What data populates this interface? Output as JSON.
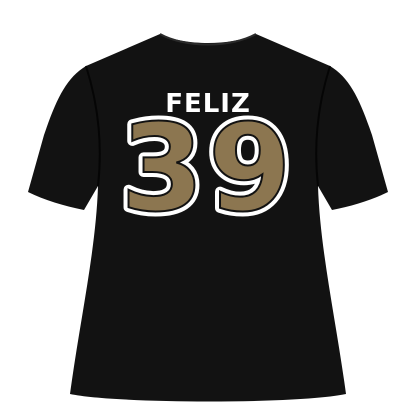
{
  "product": {
    "player_name": "FELIZ",
    "player_number": "39"
  },
  "colors": {
    "background": "#ffffff",
    "shirt": "#121212",
    "shirt_shadow": "#050505",
    "name_text": "#ffffff",
    "number_fill": "#8c7650",
    "number_outline": "#ffffff"
  },
  "icons": {
    "garment": "tshirt-back-icon"
  }
}
